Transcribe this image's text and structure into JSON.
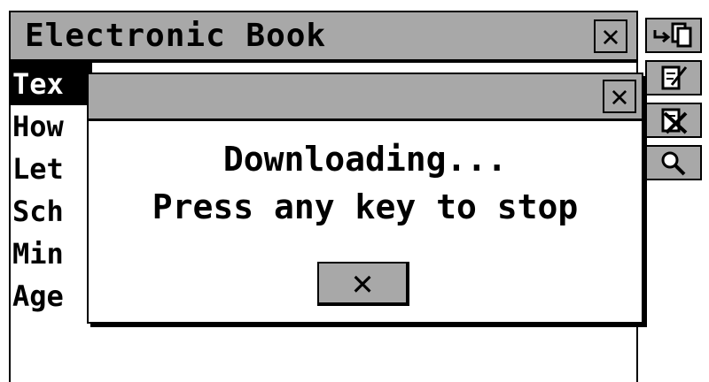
{
  "window": {
    "title": "Electronic Book",
    "close_symbol": "✕"
  },
  "list": {
    "items": [
      {
        "label": "Tex",
        "selected": true
      },
      {
        "label": "How",
        "selected": false
      },
      {
        "label": "Let",
        "selected": false
      },
      {
        "label": "Sch",
        "selected": false
      },
      {
        "label": "Min",
        "selected": false
      },
      {
        "label": "Age",
        "selected": false
      }
    ]
  },
  "toolbar": {
    "buttons": [
      {
        "icon": "enter-book-icon"
      },
      {
        "icon": "edit-icon"
      },
      {
        "icon": "delete-icon"
      },
      {
        "icon": "search-icon"
      }
    ]
  },
  "dialog": {
    "close_symbol": "✕",
    "message_line1": "Downloading...",
    "message_line2": "Press any key to stop",
    "cancel_symbol": "✕"
  },
  "colors": {
    "bar_gray": "#a8a8a8",
    "ink": "#000000",
    "background": "#ffffff"
  }
}
